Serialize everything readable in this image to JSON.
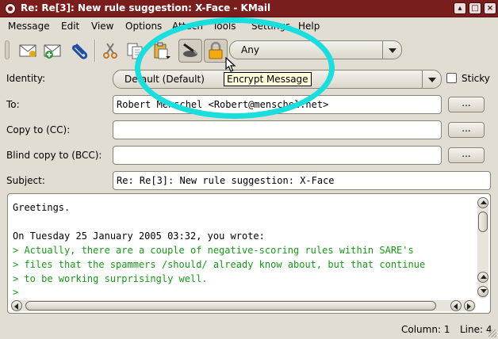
{
  "window": {
    "title": "Re: Re[3]: New rule suggestion: X-Face - KMail"
  },
  "menu": [
    {
      "label": "Message"
    },
    {
      "label": "Edit"
    },
    {
      "label": "View"
    },
    {
      "label": "Options"
    },
    {
      "label": "Attach"
    },
    {
      "label": "Tools"
    },
    {
      "label": "Settings"
    },
    {
      "label": "Help"
    }
  ],
  "toolbar": {
    "transport_select": "Any",
    "tooltip": "Encrypt Message"
  },
  "identity": {
    "label": "Identity:",
    "value": "Default (Default)",
    "sticky_label": "Sticky"
  },
  "fields": {
    "to": {
      "label": "To:",
      "value": "Robert Menschel <Robert@menschel.net>",
      "button": "..."
    },
    "cc": {
      "label": "Copy to (CC):",
      "value": "",
      "button": "..."
    },
    "bcc": {
      "label": "Blind copy to (BCC):",
      "value": "",
      "button": "..."
    },
    "subject": {
      "label": "Subject:",
      "value": "Re: Re[3]: New rule suggestion: X-Face"
    }
  },
  "body": [
    "Greetings.",
    "",
    "On Tuesday 25 January 2005 03:32, you wrote:",
    "> Actually, there are a couple of negative-scoring rules within SARE's",
    "> files that the spammers /should/ already know about, but that continue",
    "> to be working surprisingly well.",
    ">"
  ],
  "status": {
    "column": "Column: 1",
    "line": "Line: 4"
  },
  "colors": {
    "titlebar": "#7a1d1d",
    "quote_text": "#149a14",
    "highlight": "#19dede"
  }
}
